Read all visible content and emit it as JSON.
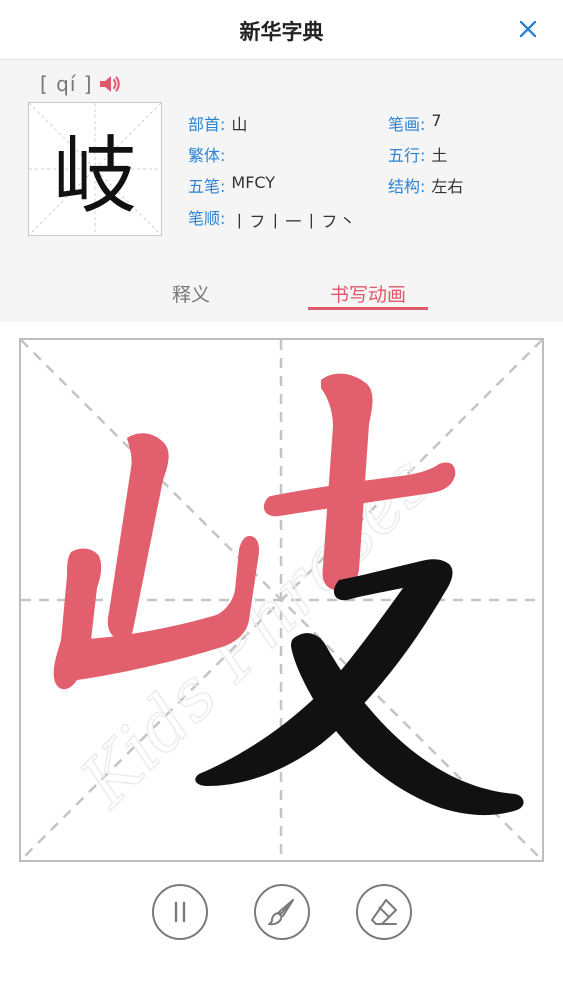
{
  "header": {
    "title": "新华字典"
  },
  "entry": {
    "pinyin": "[ qí ]",
    "character": "岐",
    "radical_label": "部首:",
    "radical": "山",
    "traditional_label": "繁体:",
    "traditional": "",
    "wubi_label": "五笔:",
    "wubi": "MFCY",
    "stroke_order_label": "笔顺:",
    "stroke_order": "丨フ丨一丨フ丶",
    "strokes_label": "笔画:",
    "strokes": "7",
    "element_label": "五行:",
    "element": "土",
    "structure_label": "结构:",
    "structure": "左右"
  },
  "tabs": {
    "definition": "释义",
    "animation": "书写动画",
    "active": "animation"
  },
  "animation": {
    "strokes_drawn": 5,
    "strokes_total": 7
  },
  "watermark": "Kids Phrases",
  "colors": {
    "accent": "#e0596a",
    "label_blue": "#2b84d4",
    "stroke_black": "#111111",
    "guide": "#bdbdbd"
  },
  "icons": {
    "close": "close-icon",
    "speaker": "speaker-icon",
    "pause": "pause-icon",
    "brush": "brush-icon",
    "eraser": "eraser-icon"
  }
}
